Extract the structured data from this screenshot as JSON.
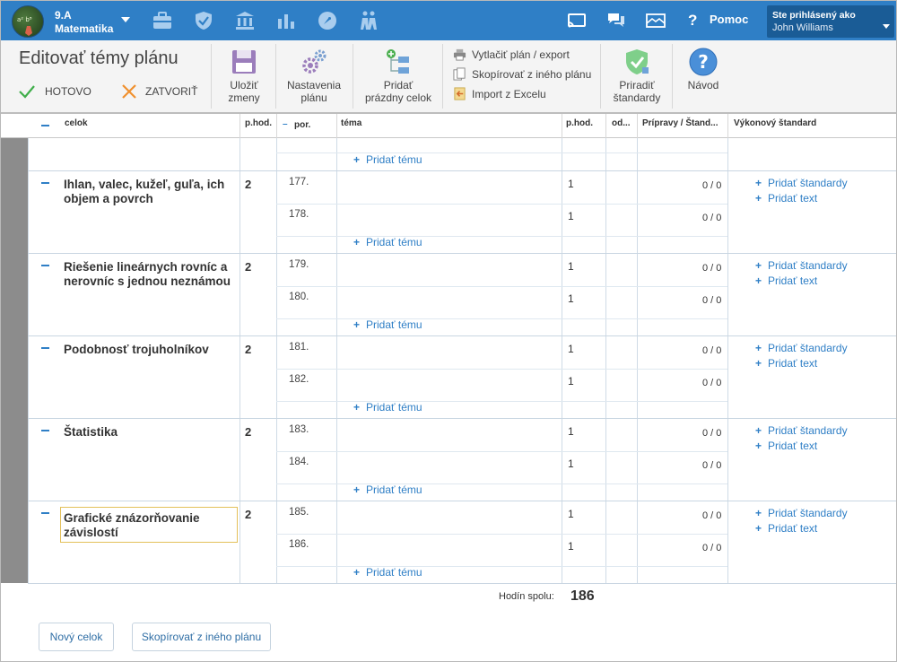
{
  "header": {
    "class_name": "9.A",
    "subject": "Matematika",
    "help_label": "Pomoc",
    "user_label": "Ste prihlásený ako",
    "user_name": "John Williams",
    "nav_icons": [
      "briefcase-icon",
      "shield-icon",
      "institution-icon",
      "bar-chart-icon",
      "rocket-icon",
      "students-icon"
    ],
    "right_icons": [
      "cast-icon",
      "chat-icon",
      "mail-icon"
    ]
  },
  "toolbar": {
    "title": "Editovať témy plánu",
    "done_label": "HOTOVO",
    "close_label": "ZATVORIŤ",
    "save_line1": "Uložiť",
    "save_line2": "zmeny",
    "settings_line1": "Nastavenia",
    "settings_line2": "plánu",
    "add_unit_line1": "Pridať",
    "add_unit_line2": "prázdny celok",
    "print_label": "Vytlačiť plán / export",
    "copy_label": "Skopírovať z iného plánu",
    "import_label": "Import z Excelu",
    "assign_line1": "Priradiť",
    "assign_line2": "štandardy",
    "guide_label": "Návod"
  },
  "table": {
    "headers": {
      "celok": "celok",
      "phod": "p.hod.",
      "minus": "–",
      "por": "por.",
      "tema": "téma",
      "phod2": "p.hod.",
      "od": "od...",
      "pripravy": "Prípravy / Štand...",
      "vykonovy": "Výkonový štandard"
    },
    "add_topic": "Pridať tému",
    "add_standards": "Pridať štandardy",
    "add_text": "Pridať text",
    "units": [
      {
        "name": "Ihlan, valec, kužeľ, guľa, ich objem a povrch",
        "hours": "2",
        "topics": [
          {
            "por": "177.",
            "hod": "1",
            "ratio": "0 / 0"
          },
          {
            "por": "178.",
            "hod": "1",
            "ratio": "0 / 0"
          }
        ]
      },
      {
        "name": "Riešenie lineárnych rovníc a nerovníc s jednou neznámou",
        "hours": "2",
        "topics": [
          {
            "por": "179.",
            "hod": "1",
            "ratio": "0 / 0"
          },
          {
            "por": "180.",
            "hod": "1",
            "ratio": "0 / 0"
          }
        ]
      },
      {
        "name": "Podobnosť trojuholníkov",
        "hours": "2",
        "topics": [
          {
            "por": "181.",
            "hod": "1",
            "ratio": "0 / 0"
          },
          {
            "por": "182.",
            "hod": "1",
            "ratio": "0 / 0"
          }
        ]
      },
      {
        "name": "Štatistika",
        "hours": "2",
        "topics": [
          {
            "por": "183.",
            "hod": "1",
            "ratio": "0 / 0"
          },
          {
            "por": "184.",
            "hod": "1",
            "ratio": "0 / 0"
          }
        ]
      },
      {
        "name": "Grafické znázorňovanie závislostí",
        "hours": "2",
        "topics": [
          {
            "por": "185.",
            "hod": "1",
            "ratio": "0 / 0"
          },
          {
            "por": "186.",
            "hod": "1",
            "ratio": "0 / 0"
          }
        ]
      }
    ]
  },
  "footer": {
    "total_label": "Hodín spolu:",
    "total_value": "186",
    "new_unit_label": "Nový celok",
    "copy_label": "Skopírovať z iného plánu"
  }
}
